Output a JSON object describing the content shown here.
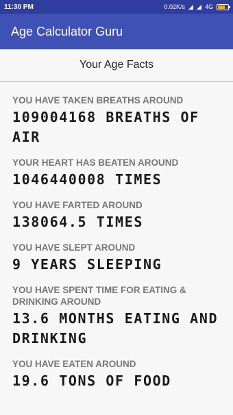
{
  "status_bar": {
    "time": "11:30 PM",
    "net_speed": "0.02K/s",
    "network": "4G",
    "battery_level": 0.7
  },
  "app_bar": {
    "title": "Age Calculator Guru"
  },
  "section": {
    "title": "Your Age Facts"
  },
  "facts": [
    {
      "label": "YOU HAVE TAKEN BREATHS AROUND",
      "value": "109004168 BREATHS OF AIR"
    },
    {
      "label": "YOUR HEART HAS BEATEN AROUND",
      "value": "1046440008 TIMES"
    },
    {
      "label": "YOU HAVE FARTED AROUND",
      "value": "138064.5 TIMES"
    },
    {
      "label": "YOU HAVE SLEPT AROUND",
      "value": "9 YEARS SLEEPING"
    },
    {
      "label": "YOU HAVE SPENT TIME FOR EATING & DRINKING AROUND",
      "value": "13.6 MONTHS EATING AND DRINKING"
    },
    {
      "label": "YOU HAVE EATEN AROUND",
      "value": "19.6 TONS OF FOOD"
    }
  ],
  "colors": {
    "status_bar": "#2f3e9e",
    "app_bar": "#3f51b5",
    "label": "#777777",
    "divider": "#c8d8c8"
  }
}
